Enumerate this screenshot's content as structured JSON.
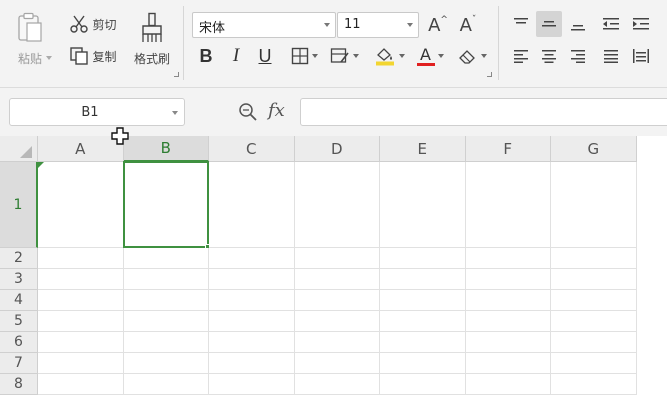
{
  "clipboard": {
    "paste_label": "粘贴",
    "cut_label": "剪切",
    "copy_label": "复制",
    "format_painter_label": "格式刷"
  },
  "font": {
    "family": "宋体",
    "size": "11",
    "increase_glyph": "A",
    "decrease_glyph": "A",
    "bold_glyph": "B",
    "italic_glyph": "I",
    "underline_glyph": "U",
    "font_color_glyph": "A",
    "font_color": "#e02020",
    "fill_color": "#f2d530"
  },
  "formula_bar": {
    "name_box_value": "B1",
    "fx_label": "fx",
    "formula_value": ""
  },
  "sheet": {
    "columns": [
      "A",
      "B",
      "C",
      "D",
      "E",
      "F",
      "G"
    ],
    "rows": [
      "1",
      "2",
      "3",
      "4",
      "5",
      "6",
      "7",
      "8"
    ],
    "selected_cell": "B1",
    "accent_color": "#3f9140"
  }
}
